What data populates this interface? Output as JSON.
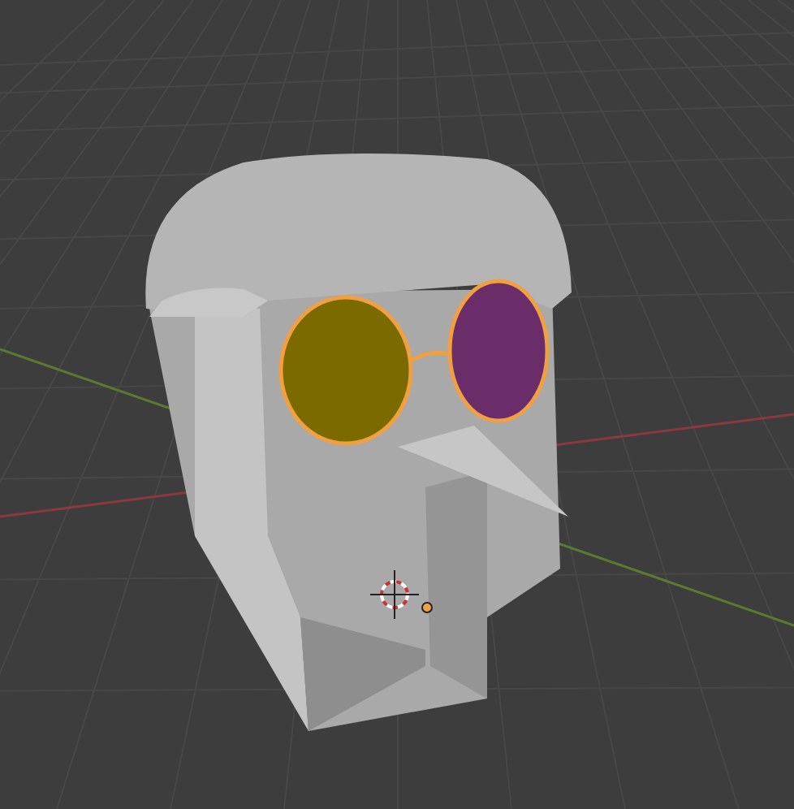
{
  "viewport": {
    "glasses": {
      "selected": true
    }
  }
}
